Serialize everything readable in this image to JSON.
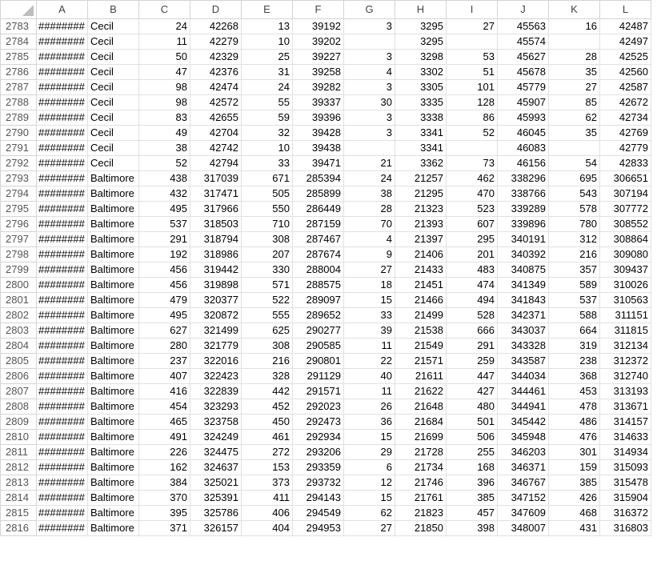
{
  "columns": [
    "A",
    "B",
    "C",
    "D",
    "E",
    "F",
    "G",
    "H",
    "I",
    "J",
    "K",
    "L"
  ],
  "rows": [
    {
      "n": "2783",
      "a": "########",
      "b": "Cecil",
      "c": "24",
      "d": "42268",
      "e": "13",
      "f": "39192",
      "g": "3",
      "h": "3295",
      "i": "27",
      "j": "45563",
      "k": "16",
      "l": "42487"
    },
    {
      "n": "2784",
      "a": "########",
      "b": "Cecil",
      "c": "11",
      "d": "42279",
      "e": "10",
      "f": "39202",
      "g": "",
      "h": "3295",
      "i": "",
      "j": "45574",
      "k": "",
      "l": "42497"
    },
    {
      "n": "2785",
      "a": "########",
      "b": "Cecil",
      "c": "50",
      "d": "42329",
      "e": "25",
      "f": "39227",
      "g": "3",
      "h": "3298",
      "i": "53",
      "j": "45627",
      "k": "28",
      "l": "42525"
    },
    {
      "n": "2786",
      "a": "########",
      "b": "Cecil",
      "c": "47",
      "d": "42376",
      "e": "31",
      "f": "39258",
      "g": "4",
      "h": "3302",
      "i": "51",
      "j": "45678",
      "k": "35",
      "l": "42560"
    },
    {
      "n": "2787",
      "a": "########",
      "b": "Cecil",
      "c": "98",
      "d": "42474",
      "e": "24",
      "f": "39282",
      "g": "3",
      "h": "3305",
      "i": "101",
      "j": "45779",
      "k": "27",
      "l": "42587"
    },
    {
      "n": "2788",
      "a": "########",
      "b": "Cecil",
      "c": "98",
      "d": "42572",
      "e": "55",
      "f": "39337",
      "g": "30",
      "h": "3335",
      "i": "128",
      "j": "45907",
      "k": "85",
      "l": "42672"
    },
    {
      "n": "2789",
      "a": "########",
      "b": "Cecil",
      "c": "83",
      "d": "42655",
      "e": "59",
      "f": "39396",
      "g": "3",
      "h": "3338",
      "i": "86",
      "j": "45993",
      "k": "62",
      "l": "42734"
    },
    {
      "n": "2790",
      "a": "########",
      "b": "Cecil",
      "c": "49",
      "d": "42704",
      "e": "32",
      "f": "39428",
      "g": "3",
      "h": "3341",
      "i": "52",
      "j": "46045",
      "k": "35",
      "l": "42769"
    },
    {
      "n": "2791",
      "a": "########",
      "b": "Cecil",
      "c": "38",
      "d": "42742",
      "e": "10",
      "f": "39438",
      "g": "",
      "h": "3341",
      "i": "",
      "j": "46083",
      "k": "",
      "l": "42779"
    },
    {
      "n": "2792",
      "a": "########",
      "b": "Cecil",
      "c": "52",
      "d": "42794",
      "e": "33",
      "f": "39471",
      "g": "21",
      "h": "3362",
      "i": "73",
      "j": "46156",
      "k": "54",
      "l": "42833"
    },
    {
      "n": "2793",
      "a": "########",
      "b": "Baltimore",
      "c": "438",
      "d": "317039",
      "e": "671",
      "f": "285394",
      "g": "24",
      "h": "21257",
      "i": "462",
      "j": "338296",
      "k": "695",
      "l": "306651"
    },
    {
      "n": "2794",
      "a": "########",
      "b": "Baltimore",
      "c": "432",
      "d": "317471",
      "e": "505",
      "f": "285899",
      "g": "38",
      "h": "21295",
      "i": "470",
      "j": "338766",
      "k": "543",
      "l": "307194"
    },
    {
      "n": "2795",
      "a": "########",
      "b": "Baltimore",
      "c": "495",
      "d": "317966",
      "e": "550",
      "f": "286449",
      "g": "28",
      "h": "21323",
      "i": "523",
      "j": "339289",
      "k": "578",
      "l": "307772"
    },
    {
      "n": "2796",
      "a": "########",
      "b": "Baltimore",
      "c": "537",
      "d": "318503",
      "e": "710",
      "f": "287159",
      "g": "70",
      "h": "21393",
      "i": "607",
      "j": "339896",
      "k": "780",
      "l": "308552"
    },
    {
      "n": "2797",
      "a": "########",
      "b": "Baltimore",
      "c": "291",
      "d": "318794",
      "e": "308",
      "f": "287467",
      "g": "4",
      "h": "21397",
      "i": "295",
      "j": "340191",
      "k": "312",
      "l": "308864"
    },
    {
      "n": "2798",
      "a": "########",
      "b": "Baltimore",
      "c": "192",
      "d": "318986",
      "e": "207",
      "f": "287674",
      "g": "9",
      "h": "21406",
      "i": "201",
      "j": "340392",
      "k": "216",
      "l": "309080"
    },
    {
      "n": "2799",
      "a": "########",
      "b": "Baltimore",
      "c": "456",
      "d": "319442",
      "e": "330",
      "f": "288004",
      "g": "27",
      "h": "21433",
      "i": "483",
      "j": "340875",
      "k": "357",
      "l": "309437"
    },
    {
      "n": "2800",
      "a": "########",
      "b": "Baltimore",
      "c": "456",
      "d": "319898",
      "e": "571",
      "f": "288575",
      "g": "18",
      "h": "21451",
      "i": "474",
      "j": "341349",
      "k": "589",
      "l": "310026"
    },
    {
      "n": "2801",
      "a": "########",
      "b": "Baltimore",
      "c": "479",
      "d": "320377",
      "e": "522",
      "f": "289097",
      "g": "15",
      "h": "21466",
      "i": "494",
      "j": "341843",
      "k": "537",
      "l": "310563"
    },
    {
      "n": "2802",
      "a": "########",
      "b": "Baltimore",
      "c": "495",
      "d": "320872",
      "e": "555",
      "f": "289652",
      "g": "33",
      "h": "21499",
      "i": "528",
      "j": "342371",
      "k": "588",
      "l": "311151"
    },
    {
      "n": "2803",
      "a": "########",
      "b": "Baltimore",
      "c": "627",
      "d": "321499",
      "e": "625",
      "f": "290277",
      "g": "39",
      "h": "21538",
      "i": "666",
      "j": "343037",
      "k": "664",
      "l": "311815"
    },
    {
      "n": "2804",
      "a": "########",
      "b": "Baltimore",
      "c": "280",
      "d": "321779",
      "e": "308",
      "f": "290585",
      "g": "11",
      "h": "21549",
      "i": "291",
      "j": "343328",
      "k": "319",
      "l": "312134"
    },
    {
      "n": "2805",
      "a": "########",
      "b": "Baltimore",
      "c": "237",
      "d": "322016",
      "e": "216",
      "f": "290801",
      "g": "22",
      "h": "21571",
      "i": "259",
      "j": "343587",
      "k": "238",
      "l": "312372"
    },
    {
      "n": "2806",
      "a": "########",
      "b": "Baltimore",
      "c": "407",
      "d": "322423",
      "e": "328",
      "f": "291129",
      "g": "40",
      "h": "21611",
      "i": "447",
      "j": "344034",
      "k": "368",
      "l": "312740"
    },
    {
      "n": "2807",
      "a": "########",
      "b": "Baltimore",
      "c": "416",
      "d": "322839",
      "e": "442",
      "f": "291571",
      "g": "11",
      "h": "21622",
      "i": "427",
      "j": "344461",
      "k": "453",
      "l": "313193"
    },
    {
      "n": "2808",
      "a": "########",
      "b": "Baltimore",
      "c": "454",
      "d": "323293",
      "e": "452",
      "f": "292023",
      "g": "26",
      "h": "21648",
      "i": "480",
      "j": "344941",
      "k": "478",
      "l": "313671"
    },
    {
      "n": "2809",
      "a": "########",
      "b": "Baltimore",
      "c": "465",
      "d": "323758",
      "e": "450",
      "f": "292473",
      "g": "36",
      "h": "21684",
      "i": "501",
      "j": "345442",
      "k": "486",
      "l": "314157"
    },
    {
      "n": "2810",
      "a": "########",
      "b": "Baltimore",
      "c": "491",
      "d": "324249",
      "e": "461",
      "f": "292934",
      "g": "15",
      "h": "21699",
      "i": "506",
      "j": "345948",
      "k": "476",
      "l": "314633"
    },
    {
      "n": "2811",
      "a": "########",
      "b": "Baltimore",
      "c": "226",
      "d": "324475",
      "e": "272",
      "f": "293206",
      "g": "29",
      "h": "21728",
      "i": "255",
      "j": "346203",
      "k": "301",
      "l": "314934"
    },
    {
      "n": "2812",
      "a": "########",
      "b": "Baltimore",
      "c": "162",
      "d": "324637",
      "e": "153",
      "f": "293359",
      "g": "6",
      "h": "21734",
      "i": "168",
      "j": "346371",
      "k": "159",
      "l": "315093"
    },
    {
      "n": "2813",
      "a": "########",
      "b": "Baltimore",
      "c": "384",
      "d": "325021",
      "e": "373",
      "f": "293732",
      "g": "12",
      "h": "21746",
      "i": "396",
      "j": "346767",
      "k": "385",
      "l": "315478"
    },
    {
      "n": "2814",
      "a": "########",
      "b": "Baltimore",
      "c": "370",
      "d": "325391",
      "e": "411",
      "f": "294143",
      "g": "15",
      "h": "21761",
      "i": "385",
      "j": "347152",
      "k": "426",
      "l": "315904"
    },
    {
      "n": "2815",
      "a": "########",
      "b": "Baltimore",
      "c": "395",
      "d": "325786",
      "e": "406",
      "f": "294549",
      "g": "62",
      "h": "21823",
      "i": "457",
      "j": "347609",
      "k": "468",
      "l": "316372"
    },
    {
      "n": "2816",
      "a": "########",
      "b": "Baltimore",
      "c": "371",
      "d": "326157",
      "e": "404",
      "f": "294953",
      "g": "27",
      "h": "21850",
      "i": "398",
      "j": "348007",
      "k": "431",
      "l": "316803"
    }
  ]
}
